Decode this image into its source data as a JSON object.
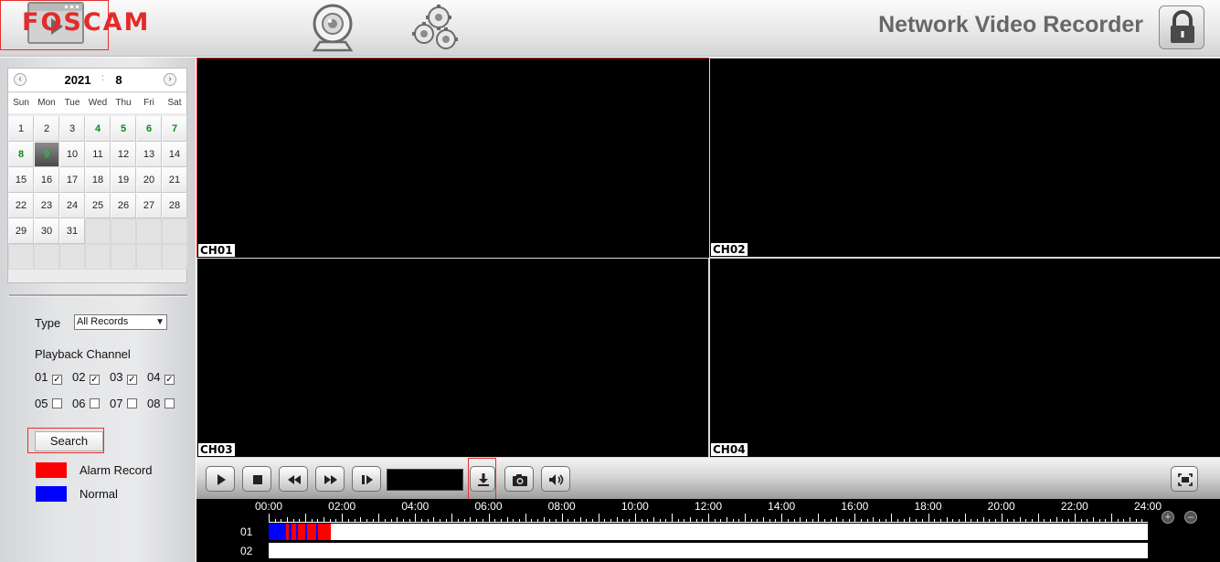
{
  "header": {
    "logo": "FOSCAM",
    "title": "Network Video Recorder",
    "nav": [
      {
        "name": "live-view",
        "icon": "webcam-icon"
      },
      {
        "name": "settings",
        "icon": "gears-icon"
      },
      {
        "name": "playback",
        "icon": "playback-icon"
      }
    ],
    "lock_icon": "lock-icon"
  },
  "calendar": {
    "year": "2021",
    "month": "8",
    "weekdays": [
      "Sun",
      "Mon",
      "Tue",
      "Wed",
      "Thu",
      "Fri",
      "Sat"
    ],
    "days": [
      "1",
      "2",
      "3",
      "4",
      "5",
      "6",
      "7",
      "8",
      "9",
      "10",
      "11",
      "12",
      "13",
      "14",
      "15",
      "16",
      "17",
      "18",
      "19",
      "20",
      "21",
      "22",
      "23",
      "24",
      "25",
      "26",
      "27",
      "28",
      "29",
      "30",
      "31"
    ],
    "days_with_records": [
      "4",
      "5",
      "6",
      "7",
      "8",
      "9"
    ],
    "selected_day": "9",
    "first_weekday_index": 0
  },
  "search": {
    "type_label": "Type",
    "type_value": "All Records",
    "channel_label": "Playback Channel",
    "channels": [
      {
        "label": "01",
        "checked": true
      },
      {
        "label": "02",
        "checked": true
      },
      {
        "label": "03",
        "checked": true
      },
      {
        "label": "04",
        "checked": true
      },
      {
        "label": "05",
        "checked": false
      },
      {
        "label": "06",
        "checked": false
      },
      {
        "label": "07",
        "checked": false
      },
      {
        "label": "08",
        "checked": false
      }
    ],
    "button_label": "Search"
  },
  "legend": {
    "alarm_label": "Alarm Record",
    "normal_label": "Normal",
    "alarm_color": "#ff0000",
    "normal_color": "#0000ff"
  },
  "video": {
    "channels": [
      "CH01",
      "CH02",
      "CH03",
      "CH04"
    ],
    "selected": "CH01"
  },
  "toolbar": {
    "speed_display": "",
    "buttons": [
      "play-icon",
      "stop-icon",
      "rewind-icon",
      "fast-forward-icon",
      "step-icon",
      "download-icon",
      "camera-icon",
      "speaker-icon",
      "fullscreen-icon"
    ]
  },
  "timeline": {
    "hours": [
      "00:00",
      "02:00",
      "04:00",
      "06:00",
      "08:00",
      "10:00",
      "12:00",
      "14:00",
      "16:00",
      "18:00",
      "20:00",
      "22:00",
      "24:00"
    ],
    "rows": [
      {
        "label": "01",
        "segments": [
          {
            "start_hour": 0.0,
            "end_hour": 0.47,
            "kind": "normal"
          },
          {
            "start_hour": 0.47,
            "end_hour": 0.55,
            "kind": "alarm"
          },
          {
            "start_hour": 0.55,
            "end_hour": 0.62,
            "kind": "normal"
          },
          {
            "start_hour": 0.62,
            "end_hour": 0.76,
            "kind": "alarm"
          },
          {
            "start_hour": 0.76,
            "end_hour": 0.81,
            "kind": "normal"
          },
          {
            "start_hour": 0.81,
            "end_hour": 1.0,
            "kind": "alarm"
          },
          {
            "start_hour": 1.0,
            "end_hour": 1.04,
            "kind": "normal"
          },
          {
            "start_hour": 1.04,
            "end_hour": 1.3,
            "kind": "alarm"
          },
          {
            "start_hour": 1.3,
            "end_hour": 1.35,
            "kind": "normal"
          },
          {
            "start_hour": 1.35,
            "end_hour": 1.7,
            "kind": "alarm"
          }
        ]
      },
      {
        "label": "02",
        "segments": []
      }
    ],
    "zoom_in_icon": "zoom-in-icon",
    "zoom_out_icon": "zoom-out-icon"
  }
}
